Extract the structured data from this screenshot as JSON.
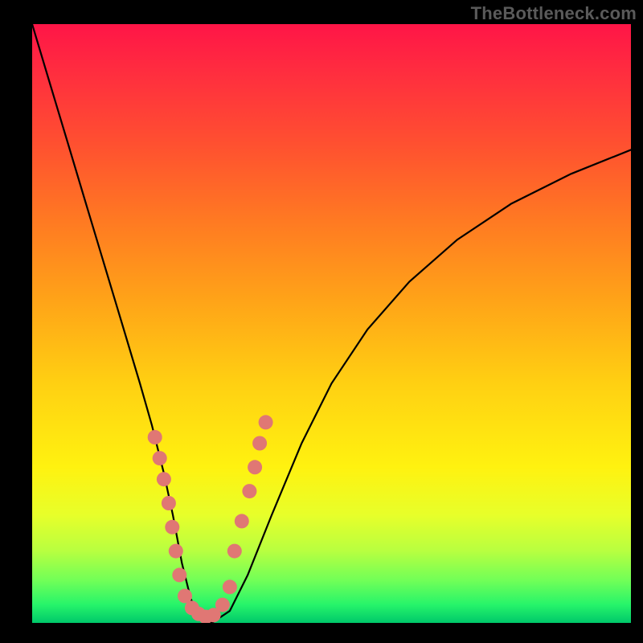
{
  "watermark": "TheBottleneck.com",
  "chart_data": {
    "type": "line",
    "title": "",
    "xlabel": "",
    "ylabel": "",
    "xlim": [
      0,
      100
    ],
    "ylim": [
      0,
      100
    ],
    "x": [
      0,
      3,
      6,
      9,
      12,
      15,
      18,
      20,
      22,
      23.5,
      25,
      26.5,
      28,
      30,
      33,
      36,
      40,
      45,
      50,
      56,
      63,
      71,
      80,
      90,
      100
    ],
    "values": [
      100,
      90,
      80,
      70,
      60,
      50,
      40,
      33,
      25,
      18,
      10,
      4,
      1,
      0,
      2,
      8,
      18,
      30,
      40,
      49,
      57,
      64,
      70,
      75,
      79
    ],
    "series": [
      {
        "name": "bottleneck-curve",
        "x": [
          0,
          3,
          6,
          9,
          12,
          15,
          18,
          20,
          22,
          23.5,
          25,
          26.5,
          28,
          30,
          33,
          36,
          40,
          45,
          50,
          56,
          63,
          71,
          80,
          90,
          100
        ],
        "y": [
          100,
          90,
          80,
          70,
          60,
          50,
          40,
          33,
          25,
          18,
          10,
          4,
          1,
          0,
          2,
          8,
          18,
          30,
          40,
          49,
          57,
          64,
          70,
          75,
          79
        ]
      }
    ],
    "markers": {
      "name": "data-points",
      "color": "#e07774",
      "x": [
        20.5,
        21.3,
        22.0,
        22.8,
        23.4,
        24.0,
        24.6,
        25.5,
        26.7,
        27.8,
        29.0,
        30.3,
        31.8,
        33.0,
        33.8,
        35.0,
        36.3,
        37.2,
        38.0,
        39.0
      ],
      "y": [
        31.0,
        27.5,
        24.0,
        20.0,
        16.0,
        12.0,
        8.0,
        4.5,
        2.5,
        1.5,
        1.0,
        1.3,
        3.0,
        6.0,
        12.0,
        17.0,
        22.0,
        26.0,
        30.0,
        33.5
      ]
    },
    "background_gradient": {
      "top": "#ff1547",
      "bottom": "#00c86a"
    }
  }
}
